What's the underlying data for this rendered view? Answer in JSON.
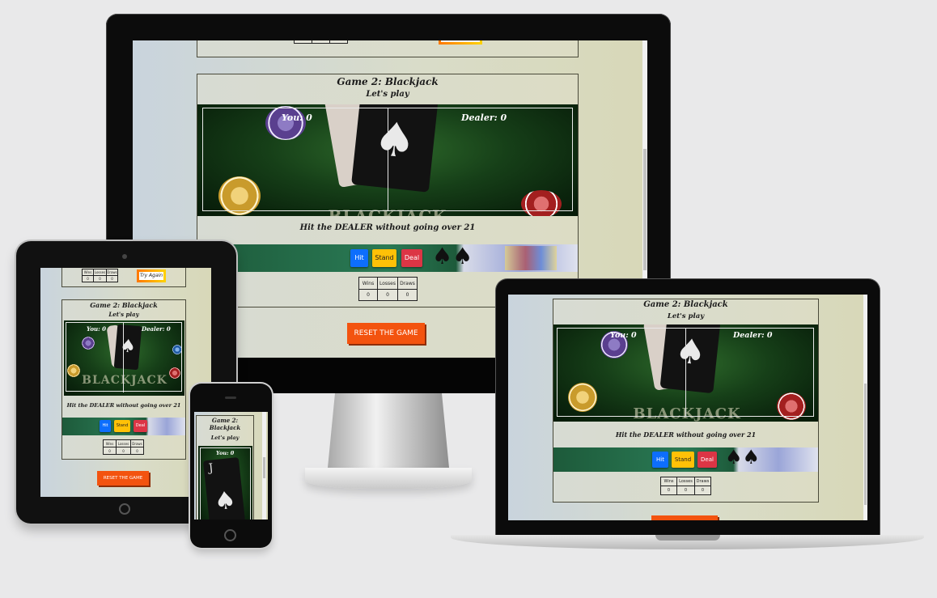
{
  "game": {
    "title": "Game 2: Blackjack",
    "subtitle": "Let's play",
    "you_score": "You: 0",
    "dealer_score": "Dealer: 0",
    "table_logo": "BLACKJACK",
    "instructions": "Hit the DEALER without going over 21",
    "buttons": {
      "hit": "Hit",
      "stand": "Stand",
      "deal": "Deal"
    },
    "stats": {
      "headers": [
        "Wins",
        "Losses",
        "Draws"
      ],
      "values": [
        "0",
        "0",
        "0"
      ]
    },
    "reset_label": "RESET THE GAME",
    "try_again_label": "Try Again"
  },
  "colors": {
    "reset": "#f3530f",
    "hit": "#0d6efd",
    "stand": "#ffc107",
    "deal": "#dc3545",
    "felt": "#163f18"
  }
}
